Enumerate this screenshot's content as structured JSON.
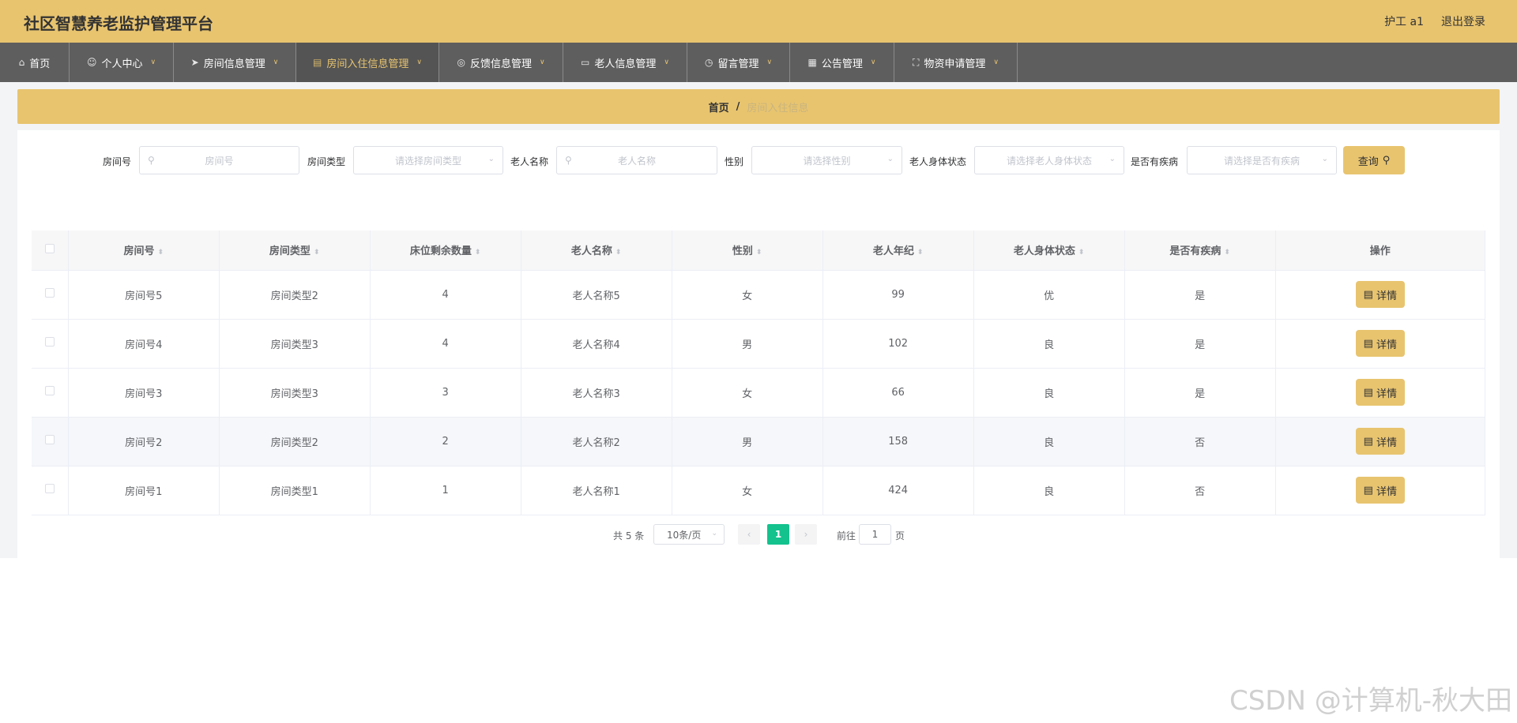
{
  "header": {
    "title": "社区智慧养老监护管理平台",
    "user": "护工 a1",
    "logout": "退出登录"
  },
  "nav": [
    {
      "label": "首页",
      "icon": "home-icon",
      "active": false
    },
    {
      "label": "个人中心",
      "icon": "user-icon",
      "active": false
    },
    {
      "label": "房间信息管理",
      "icon": "send-icon",
      "active": false
    },
    {
      "label": "房间入住信息管理",
      "icon": "clipboard-icon",
      "active": true
    },
    {
      "label": "反馈信息管理",
      "icon": "globe-icon",
      "active": false
    },
    {
      "label": "老人信息管理",
      "icon": "message-icon",
      "active": false
    },
    {
      "label": "留言管理",
      "icon": "clock-icon",
      "active": false
    },
    {
      "label": "公告管理",
      "icon": "grid-icon",
      "active": false
    },
    {
      "label": "物资申请管理",
      "icon": "fullscreen-icon",
      "active": false
    }
  ],
  "breadcrumb": {
    "home": "首页",
    "separator": "/",
    "current": "房间入住信息"
  },
  "search": {
    "room_no_label": "房间号",
    "room_no_placeholder": "房间号",
    "room_type_label": "房间类型",
    "room_type_placeholder": "请选择房间类型",
    "elder_name_label": "老人名称",
    "elder_name_placeholder": "老人名称",
    "gender_label": "性别",
    "gender_placeholder": "请选择性别",
    "health_label": "老人身体状态",
    "health_placeholder": "请选择老人身体状态",
    "disease_label": "是否有疾病",
    "disease_placeholder": "请选择是否有疾病",
    "query_label": "查询"
  },
  "table": {
    "headers": [
      "房间号",
      "房间类型",
      "床位剩余数量",
      "老人名称",
      "性别",
      "老人年纪",
      "老人身体状态",
      "是否有疾病",
      "操作"
    ],
    "detail_label": "详情",
    "rows": [
      {
        "room": "房间号5",
        "type": "房间类型2",
        "beds": "4",
        "name": "老人名称5",
        "gender": "女",
        "age": "99",
        "health": "优",
        "disease": "是"
      },
      {
        "room": "房间号4",
        "type": "房间类型3",
        "beds": "4",
        "name": "老人名称4",
        "gender": "男",
        "age": "102",
        "health": "良",
        "disease": "是"
      },
      {
        "room": "房间号3",
        "type": "房间类型3",
        "beds": "3",
        "name": "老人名称3",
        "gender": "女",
        "age": "66",
        "health": "良",
        "disease": "是"
      },
      {
        "room": "房间号2",
        "type": "房间类型2",
        "beds": "2",
        "name": "老人名称2",
        "gender": "男",
        "age": "158",
        "health": "良",
        "disease": "否"
      },
      {
        "room": "房间号1",
        "type": "房间类型1",
        "beds": "1",
        "name": "老人名称1",
        "gender": "女",
        "age": "424",
        "health": "良",
        "disease": "否"
      }
    ]
  },
  "pagination": {
    "total": "共 5 条",
    "page_size": "10条/页",
    "current_page": "1",
    "goto_label": "前往",
    "goto_value": "1",
    "goto_unit": "页"
  },
  "watermark": "CSDN @计算机-秋大田",
  "colors": {
    "accent": "#e8c46f",
    "nav_bg": "#5e5e5e",
    "page_active": "#14c28e"
  }
}
